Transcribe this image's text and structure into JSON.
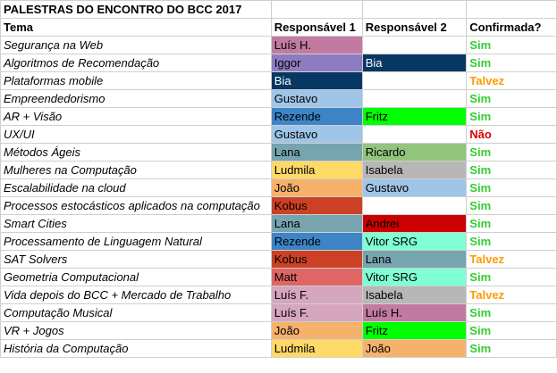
{
  "sheet": {
    "title": "PALESTRAS DO ENCONTRO DO BCC 2017",
    "headers": {
      "topic": "Tema",
      "resp1": "Responsável 1",
      "resp2": "Responsável 2",
      "confirmed": "Confirmada?"
    },
    "status_colors": {
      "Sim": "#33cc33",
      "Talvez": "#ff9900",
      "Não": "#dd0000"
    },
    "rows": [
      {
        "topic": "Segurança na Web",
        "resp1": {
          "name": "Luís H.",
          "color": "#c27ba0"
        },
        "resp2": {
          "name": "",
          "color": "#ffffff"
        },
        "confirmed": "Sim"
      },
      {
        "topic": "Algoritmos de Recomendação",
        "resp1": {
          "name": "Iggor",
          "color": "#8e7cc3"
        },
        "resp2": {
          "name": "Bia",
          "color": "#073763"
        },
        "confirmed": "Sim"
      },
      {
        "topic": "Plataformas mobile",
        "resp1": {
          "name": "Bia",
          "color": "#073763"
        },
        "resp2": {
          "name": "",
          "color": "#ffffff"
        },
        "confirmed": "Talvez"
      },
      {
        "topic": "Empreendedorismo",
        "resp1": {
          "name": "Gustavo",
          "color": "#9fc5e8"
        },
        "resp2": {
          "name": "",
          "color": "#ffffff"
        },
        "confirmed": "Sim"
      },
      {
        "topic": "AR + Visão",
        "resp1": {
          "name": "Rezende",
          "color": "#3d85c6"
        },
        "resp2": {
          "name": "Fritz",
          "color": "#00ff00"
        },
        "confirmed": "Sim"
      },
      {
        "topic": "UX/UI",
        "resp1": {
          "name": "Gustavo",
          "color": "#9fc5e8"
        },
        "resp2": {
          "name": "",
          "color": "#ffffff"
        },
        "confirmed": "Não"
      },
      {
        "topic": "Métodos Ágeis",
        "resp1": {
          "name": "Lana",
          "color": "#76a5af"
        },
        "resp2": {
          "name": "Ricardo",
          "color": "#93c47d"
        },
        "confirmed": "Sim"
      },
      {
        "topic": "Mulheres na Computação",
        "resp1": {
          "name": "Ludmila",
          "color": "#ffd966"
        },
        "resp2": {
          "name": "Isabela",
          "color": "#b7b7b7"
        },
        "confirmed": "Sim"
      },
      {
        "topic": "Escalabilidade na cloud",
        "resp1": {
          "name": "João",
          "color": "#f6b26b"
        },
        "resp2": {
          "name": "Gustavo",
          "color": "#9fc5e8"
        },
        "confirmed": "Sim"
      },
      {
        "topic": "Processos estocásticos aplicados na computação",
        "resp1": {
          "name": "Kobus",
          "color": "#cc4125"
        },
        "resp2": {
          "name": "",
          "color": "#ffffff"
        },
        "confirmed": "Sim"
      },
      {
        "topic": "Smart Cities",
        "resp1": {
          "name": "Lana",
          "color": "#76a5af"
        },
        "resp2": {
          "name": "Andrei",
          "color": "#cc0000"
        },
        "confirmed": "Sim"
      },
      {
        "topic": "Processamento de Linguagem Natural",
        "resp1": {
          "name": "Rezende",
          "color": "#3d85c6"
        },
        "resp2": {
          "name": "Vitor SRG",
          "color": "#7fffd4"
        },
        "confirmed": "Sim"
      },
      {
        "topic": "SAT Solvers",
        "resp1": {
          "name": "Kobus",
          "color": "#cc4125"
        },
        "resp2": {
          "name": "Lana",
          "color": "#76a5af"
        },
        "confirmed": "Talvez"
      },
      {
        "topic": "Geometria Computacional",
        "resp1": {
          "name": "Matt",
          "color": "#e06666"
        },
        "resp2": {
          "name": "Vitor SRG",
          "color": "#7fffd4"
        },
        "confirmed": "Sim"
      },
      {
        "topic": "Vida depois do BCC + Mercado de Trabalho",
        "resp1": {
          "name": "Luís F.",
          "color": "#d5a6bd"
        },
        "resp2": {
          "name": "Isabela",
          "color": "#b7b7b7"
        },
        "confirmed": "Talvez"
      },
      {
        "topic": "Computação Musical",
        "resp1": {
          "name": "Luís F.",
          "color": "#d5a6bd"
        },
        "resp2": {
          "name": "Luís H.",
          "color": "#c27ba0"
        },
        "confirmed": "Sim"
      },
      {
        "topic": "VR + Jogos",
        "resp1": {
          "name": "João",
          "color": "#f6b26b"
        },
        "resp2": {
          "name": "Fritz",
          "color": "#00ff00"
        },
        "confirmed": "Sim"
      },
      {
        "topic": "História da Computação",
        "resp1": {
          "name": "Ludmila",
          "color": "#ffd966"
        },
        "resp2": {
          "name": "João",
          "color": "#f6b26b"
        },
        "confirmed": "Sim"
      }
    ]
  }
}
